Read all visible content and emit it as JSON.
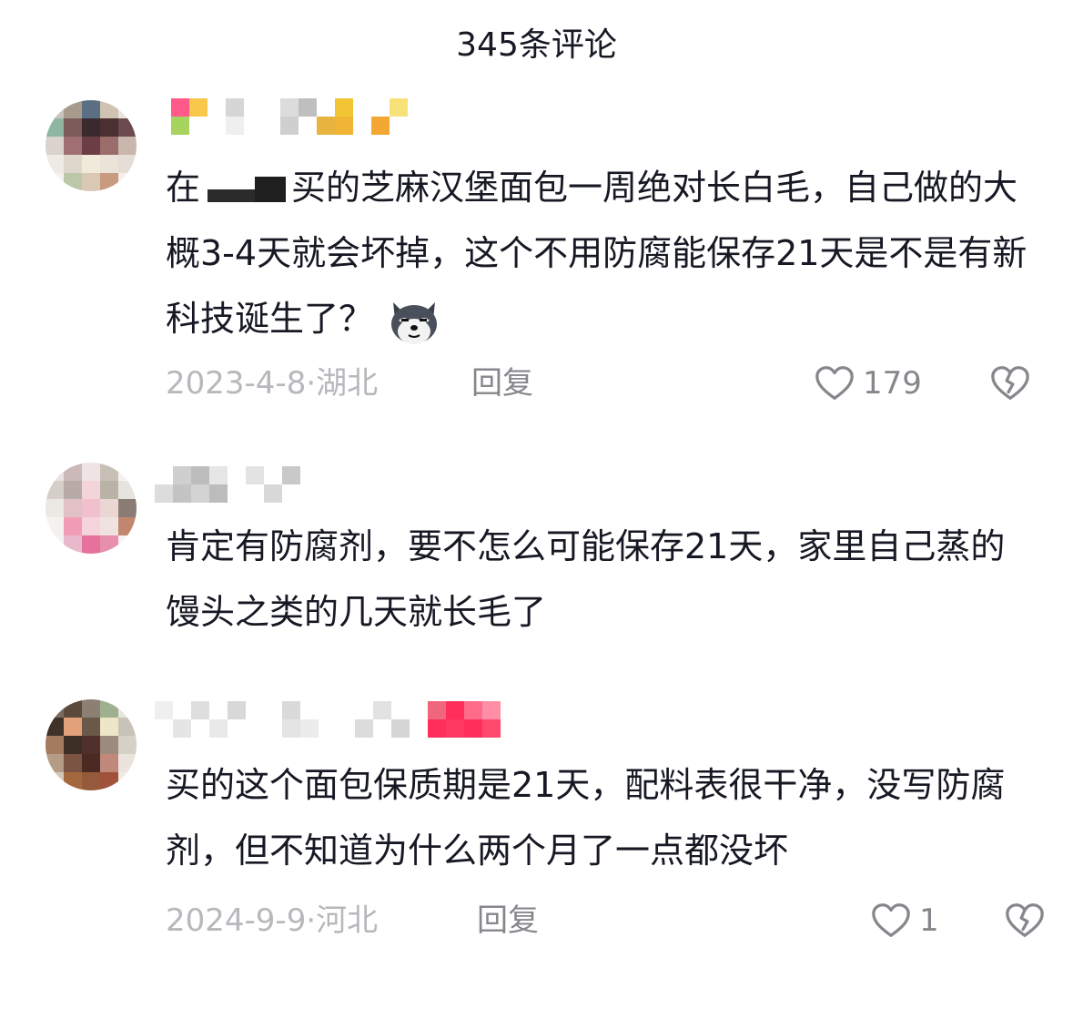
{
  "header": {
    "title": "345条评论"
  },
  "comments": [
    {
      "text_before": "在",
      "text_after": "买的芝麻汉堡面包一周绝对长白毛，自己做的大概3-4天就会坏掉，这个不用防腐能保存21天是不是有新科技诞生了？",
      "emoji": "husky-dog-emoji",
      "date": "2023-4-8·湖北",
      "reply_label": "回复",
      "like_count": "179"
    },
    {
      "text": "肯定有防腐剂，要不怎么可能保存21天，家里自己蒸的馒头之类的几天就长毛了"
    },
    {
      "text": "买的这个面包保质期是21天，配料表很干净，没写防腐剂，但不知道为什么两个月了一点都没坏",
      "date": "2024-9-9·河北",
      "reply_label": "回复",
      "like_count": "1"
    }
  ],
  "colors": {
    "text_primary": "#161823",
    "text_meta": "#b7b8bc",
    "text_secondary": "#86878c",
    "icon": "#86878c"
  },
  "icons": [
    "heart-outline-icon",
    "broken-heart-icon"
  ]
}
